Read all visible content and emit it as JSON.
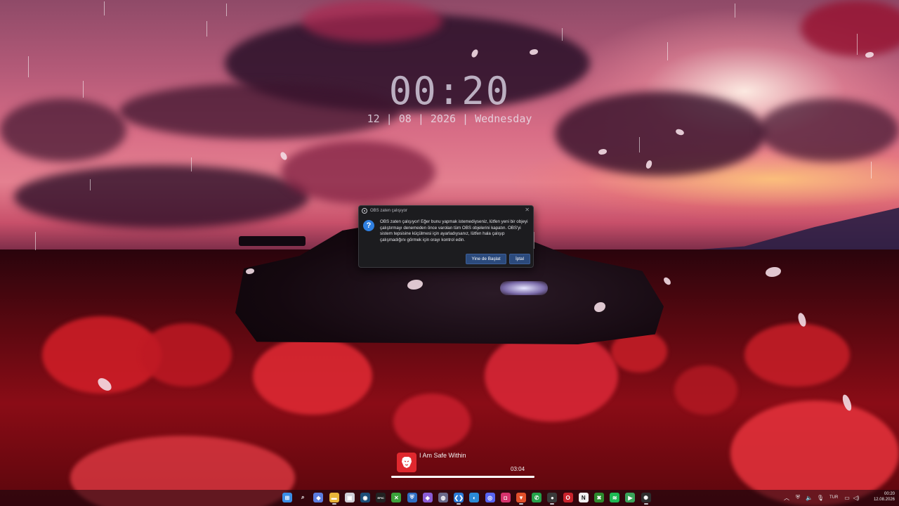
{
  "desktop": {
    "clock": {
      "time": "00:20",
      "date": "12 | 08 | 2026 | Wednesday"
    }
  },
  "dialog": {
    "title": "OBS zaten çalışıyor",
    "message": "OBS zaten çalışıyor! Eğer bunu yapmak istemediyseniz, lütfen yeni bir objeyi çalıştırmayı denemeden önce varolan tüm OBS objelerini kapatın. OBS'yi sistem tepsisine küçülmesi için ayarladıysanız, lütfen hala çalışıp çalışmadığını görmek için orayı kontrol edin.",
    "buttons": {
      "restart": "Yine de Başlat",
      "cancel": "İptal"
    },
    "close_symbol": "✕",
    "question_symbol": "?"
  },
  "media": {
    "title": "I Am Safe Within",
    "time": "03:04",
    "progress": 1.0
  },
  "taskbar": {
    "icons": [
      {
        "name": "start-icon",
        "label": "⊞",
        "color": "#3a8ee6"
      },
      {
        "name": "search-icon",
        "label": "⌕",
        "color": "transparent"
      },
      {
        "name": "copilot-icon",
        "label": "◆",
        "color": "#5b7de0"
      },
      {
        "name": "file-explorer-icon",
        "label": "▬",
        "color": "#e8b53a"
      },
      {
        "name": "store-icon",
        "label": "▣",
        "color": "#cfcfd6"
      },
      {
        "name": "steam-icon",
        "label": "◉",
        "color": "#1b4e78"
      },
      {
        "name": "epic-games-icon",
        "label": "EPIC",
        "color": "#222222"
      },
      {
        "name": "xbox-icon",
        "label": "✕",
        "color": "#3aa23a"
      },
      {
        "name": "defender-icon",
        "label": "⛨",
        "color": "#2f6ec2"
      },
      {
        "name": "visual-studio-icon",
        "label": "◈",
        "color": "#8a5cd6"
      },
      {
        "name": "github-desktop-icon",
        "label": "◍",
        "color": "#6a6a8a"
      },
      {
        "name": "vscode-icon",
        "label": "❮❯",
        "color": "#2a7ad6"
      },
      {
        "name": "edge-icon",
        "label": "◐",
        "color": "#2a8ad6"
      },
      {
        "name": "discord-icon",
        "label": "◎",
        "color": "#5865f2"
      },
      {
        "name": "instagram-icon",
        "label": "◘",
        "color": "#d6336c"
      },
      {
        "name": "brave-icon",
        "label": "▼",
        "color": "#e2502a"
      },
      {
        "name": "whatsapp-icon",
        "label": "✆",
        "color": "#25a24a"
      },
      {
        "name": "obs-icon",
        "label": "●",
        "color": "#3a3a3a"
      },
      {
        "name": "opera-icon",
        "label": "O",
        "color": "#c8232c"
      },
      {
        "name": "notion-icon",
        "label": "N",
        "color": "#f0f0f0"
      },
      {
        "name": "xbox-app-icon",
        "label": "✖",
        "color": "#2d8a2d"
      },
      {
        "name": "spotify-icon",
        "label": "≋",
        "color": "#1db954"
      },
      {
        "name": "media-player-icon",
        "label": "▶",
        "color": "#3aa35a"
      },
      {
        "name": "chatgpt-icon",
        "label": "✺",
        "color": "#2e2e2e"
      }
    ],
    "tray": {
      "language": "TUR",
      "time": "00:20",
      "date": "12.08.2026"
    }
  }
}
